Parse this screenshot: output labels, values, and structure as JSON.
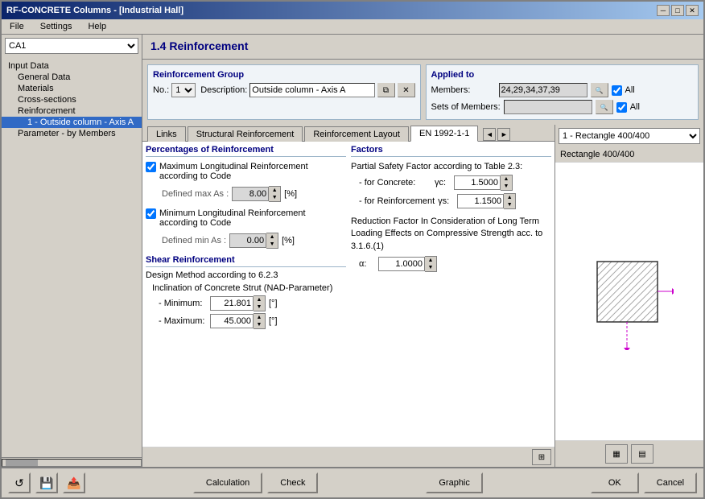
{
  "window": {
    "title": "RF-CONCRETE Columns - [Industrial Hall]",
    "close_btn": "✕",
    "minimize_btn": "─",
    "maximize_btn": "□"
  },
  "menu": {
    "items": [
      "File",
      "Settings",
      "Help"
    ]
  },
  "sidebar": {
    "dropdown_value": "CA1",
    "tree_items": [
      {
        "label": "Input Data",
        "indent": 0
      },
      {
        "label": "General Data",
        "indent": 1
      },
      {
        "label": "Materials",
        "indent": 1
      },
      {
        "label": "Cross-sections",
        "indent": 1
      },
      {
        "label": "Reinforcement",
        "indent": 1
      },
      {
        "label": "1 - Outside column - Axis A",
        "indent": 2,
        "selected": true
      },
      {
        "label": "Parameter - by Members",
        "indent": 1
      }
    ]
  },
  "panel": {
    "title": "1.4 Reinforcement"
  },
  "reinforcement_group": {
    "section_title": "Reinforcement Group",
    "no_label": "No.:",
    "no_value": "1",
    "desc_label": "Description:",
    "desc_value": "Outside column - Axis A"
  },
  "applied_to": {
    "section_title": "Applied to",
    "members_label": "Members:",
    "members_value": "24,29,34,37,39",
    "sets_label": "Sets of Members:",
    "sets_value": "",
    "all_members": "All",
    "all_sets": "All"
  },
  "tabs": [
    {
      "label": "Links",
      "active": false
    },
    {
      "label": "Structural Reinforcement",
      "active": false
    },
    {
      "label": "Reinforcement Layout",
      "active": false
    },
    {
      "label": "EN 1992-1-1",
      "active": true
    }
  ],
  "percentages": {
    "section_title": "Percentages of Reinforcement",
    "max_long_checked": true,
    "max_long_label": "Maximum Longitudinal Reinforcement according to Code",
    "max_defined_label": "Defined max As :",
    "max_defined_value": "8.00",
    "max_unit": "[%]",
    "min_long_checked": true,
    "min_long_label": "Minimum Longitudinal Reinforcement according to Code",
    "min_defined_label": "Defined min As :",
    "min_defined_value": "0.00",
    "min_unit": "[%]"
  },
  "factors": {
    "section_title": "Factors",
    "partial_title": "Partial Safety Factor according to Table 2.3:",
    "concrete_label": "- for Concrete:",
    "concrete_symbol": "γc:",
    "concrete_value": "1.5000",
    "reinf_label": "- for Reinforcement",
    "reinf_symbol": "γs:",
    "reinf_value": "1.1500",
    "reduction_title": "Reduction Factor In Consideration of Long Term Loading Effects on Compressive Strength acc. to 3.1.6.(1)",
    "reduction_symbol": "α:",
    "reduction_value": "1.0000"
  },
  "shear": {
    "section_title": "Shear Reinforcement",
    "method_label": "Design Method according to 6.2.3",
    "incline_title": "Inclination of Concrete Strut (NAD-Parameter)",
    "min_label": "- Minimum:",
    "min_value": "21.801",
    "min_unit": "[°]",
    "max_label": "- Maximum:",
    "max_value": "45.000",
    "max_unit": "[°]"
  },
  "visualization": {
    "dropdown_value": "1 - Rectangle 400/400",
    "cross_section_label": "Rectangle 400/400",
    "dropdown_options": [
      "1 - Rectangle 400/400"
    ]
  },
  "bottom_bar": {
    "calculation_label": "Calculation",
    "check_label": "Check",
    "graphic_label": "Graphic",
    "ok_label": "OK",
    "cancel_label": "Cancel"
  },
  "icons": {
    "refresh": "↺",
    "save": "💾",
    "export": "📤",
    "copy": "⧉",
    "delete": "✕",
    "arrow_left": "◄",
    "arrow_right": "►",
    "table": "⊞",
    "view1": "▦",
    "view2": "▤"
  }
}
